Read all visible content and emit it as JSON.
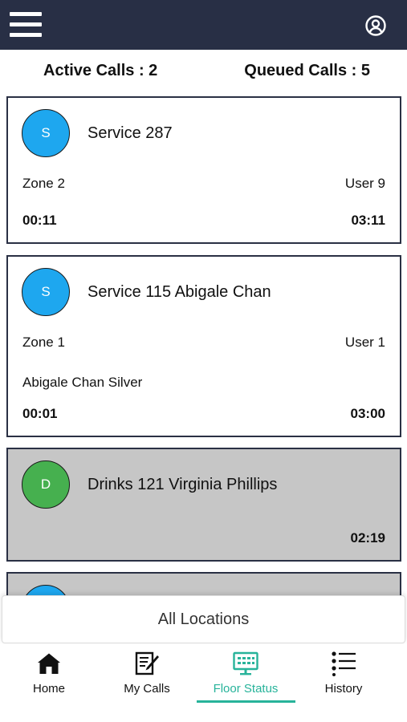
{
  "header": {
    "menu_icon": "hamburger-menu-icon",
    "account_icon": "user-circle-icon",
    "bar_color": "#282f45"
  },
  "summary": {
    "active_calls": "Active Calls : 2",
    "queued_calls": "Queued Calls : 5"
  },
  "calls": [
    {
      "initial": "S",
      "avatar_color": "#1ea7ef",
      "title": "Service 287",
      "zone": "Zone 2",
      "user": "User 9",
      "note": "",
      "elapsed": "00:11",
      "time": "03:11",
      "muted": false
    },
    {
      "initial": "S",
      "avatar_color": "#1ea7ef",
      "title": "Service 115 Abigale Chan",
      "zone": "Zone 1",
      "user": "User 1",
      "note": "Abigale Chan Silver",
      "elapsed": "00:01",
      "time": "03:00",
      "muted": false
    },
    {
      "initial": "D",
      "avatar_color": "#46b04f",
      "title": "Drinks 121 Virginia Phillips",
      "zone": "",
      "user": "",
      "note": "",
      "elapsed": "",
      "time": "02:19",
      "muted": true
    }
  ],
  "partial_card": {
    "avatar_color": "#1ea7ef",
    "muted": true
  },
  "location_filter": {
    "label": "All Locations"
  },
  "tabs": [
    {
      "label": "Home",
      "icon": "home-icon",
      "selected": false
    },
    {
      "label": "My Calls",
      "icon": "edit-document-icon",
      "selected": false
    },
    {
      "label": "Floor Status",
      "icon": "monitor-grid-icon",
      "selected": true
    },
    {
      "label": "History",
      "icon": "list-icon",
      "selected": false
    }
  ],
  "accent_color": "#27b39a"
}
